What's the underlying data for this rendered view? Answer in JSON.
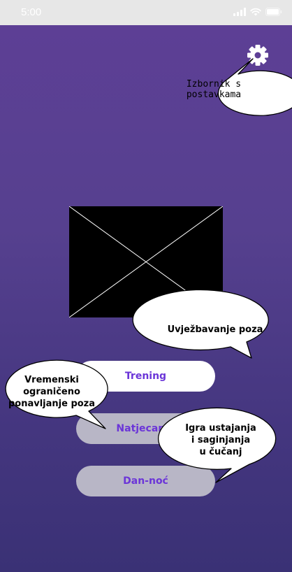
{
  "status_bar": {
    "time": "5:00"
  },
  "icons": {
    "settings": "gear-icon",
    "signal": "signal-icon",
    "wifi": "wifi-icon",
    "battery": "battery-icon",
    "image": "image-placeholder"
  },
  "buttons": {
    "training": "Trening",
    "competition": "Natjecanje",
    "day_night": "Dan-noć"
  },
  "callouts": {
    "settings_menu": [
      "Izbornik s",
      "postavkama"
    ],
    "practice_poses": "Uvježbavanje poza",
    "timed_poses": [
      "Vremenski",
      "ograničeno",
      "ponavljanje poza"
    ],
    "squat_game": [
      "Igra ustajanja",
      "i saginjanja",
      "u čučanj"
    ]
  },
  "colors": {
    "accent": "#6b35d8",
    "gradient_top": "#5e3f96",
    "gradient_bottom": "#3a3175"
  }
}
